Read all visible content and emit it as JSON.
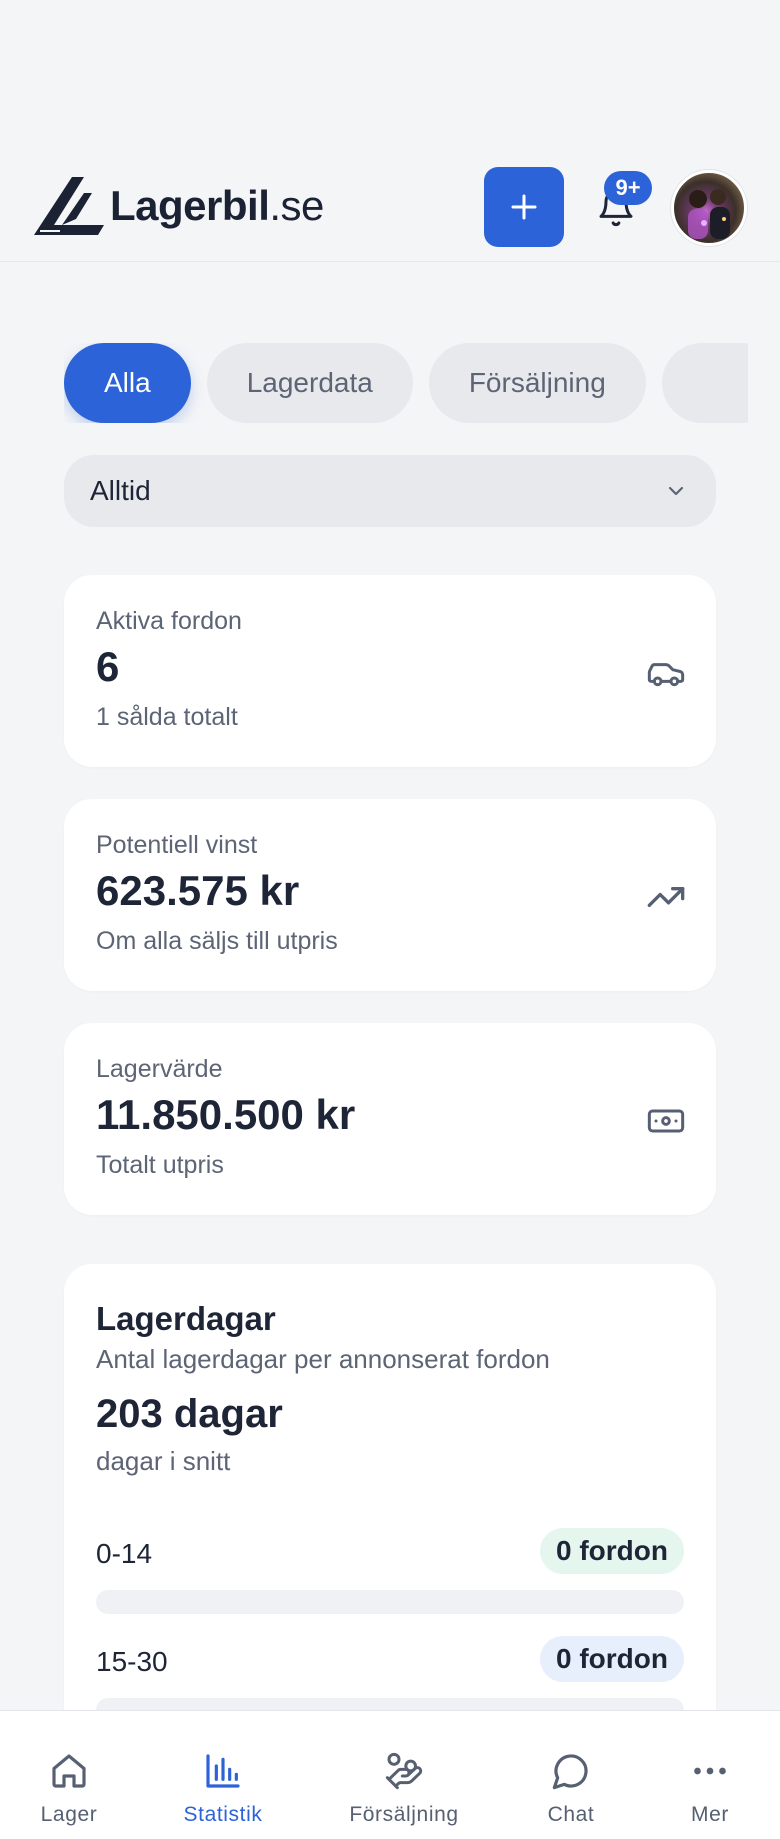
{
  "header": {
    "logo_name": "Lagerbil",
    "logo_tld": ".se",
    "add_icon": "plus-icon",
    "notifications_badge": "9+",
    "colors": {
      "accent": "#2d63d8"
    }
  },
  "tabs": [
    {
      "label": "Alla",
      "active": true
    },
    {
      "label": "Lagerdata",
      "active": false
    },
    {
      "label": "Försäljning",
      "active": false
    },
    {
      "label": "",
      "active": false
    }
  ],
  "period_select": {
    "value": "Alltid"
  },
  "stats": [
    {
      "label": "Aktiva fordon",
      "value": "6",
      "sub": "1 sålda totalt",
      "icon": "car-icon"
    },
    {
      "label": "Potentiell vinst",
      "value": "623.575 kr",
      "sub": "Om alla säljs till utpris",
      "icon": "trending-up-icon"
    },
    {
      "label": "Lagervärde",
      "value": "11.850.500 kr",
      "sub": "Totalt utpris",
      "icon": "banknote-icon"
    }
  ],
  "lagerdagar": {
    "title": "Lagerdagar",
    "subtitle": "Antal lagerdagar per annonserat fordon",
    "value": "203 dagar",
    "unit": "dagar i snitt",
    "buckets": [
      {
        "range": "0-14",
        "count": "0 fordon",
        "pill_color": "#e5f6ee",
        "fill": 0
      },
      {
        "range": "15-30",
        "count": "0 fordon",
        "pill_color": "#e7eefc",
        "fill": 0
      }
    ]
  },
  "bottom_nav": [
    {
      "label": "Lager",
      "icon": "home-icon",
      "active": false
    },
    {
      "label": "Statistik",
      "icon": "bar-chart-icon",
      "active": true
    },
    {
      "label": "Försäljning",
      "icon": "hand-coins-icon",
      "active": false
    },
    {
      "label": "Chat",
      "icon": "chat-bubble-icon",
      "active": false
    },
    {
      "label": "Mer",
      "icon": "more-dots-icon",
      "active": false
    }
  ]
}
